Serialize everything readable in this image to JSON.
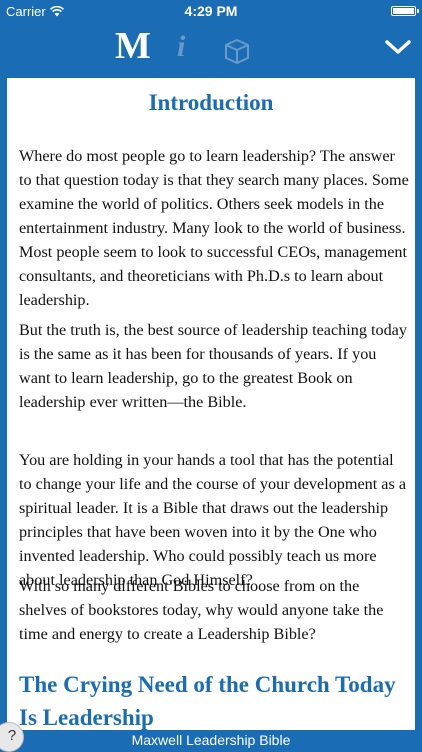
{
  "status_bar": {
    "carrier": "Carrier",
    "time": "4:29 PM",
    "battery_level": 1.0
  },
  "toolbar": {
    "logo_letter": "M",
    "info_letter": "i",
    "icons": [
      "wifi-icon",
      "book-box-icon",
      "chevron-down-icon"
    ]
  },
  "content": {
    "title": "Introduction",
    "paragraphs": [
      "Where do most people go to learn leadership? The answer to that question today is that they search many places. Some examine the world of politics. Others seek models in the entertainment industry. Many look to the world of business. Most people seem to look to successful CEOs, management consultants, and theoreticians with Ph.D.s to learn about leadership.",
      "But the truth is, the best source of leadership teaching today is the same as it has been for thousands of years. If you want to learn leadership, go to the greatest Book on leadership ever written—the Bible.",
      "You are holding in your hands a tool that has the potential to change your life and the course of your development as a spiritual leader. It is a Bible that draws out the leadership principles that have been woven into it by the One who invented leadership. Who could possibly teach us more about leadership than God Himself?",
      "With so many different Bibles to choose from on the shelves of bookstores today, why would anyone take the time and energy to create a Leadership Bible?"
    ],
    "section_heading": "The Crying Need of the Church Today Is Leadership"
  },
  "footer": {
    "title": "Maxwell Leadership Bible",
    "help_label": "?"
  },
  "colors": {
    "brand_blue": "#1a6db5",
    "muted_icon": "#6a9bc8"
  }
}
